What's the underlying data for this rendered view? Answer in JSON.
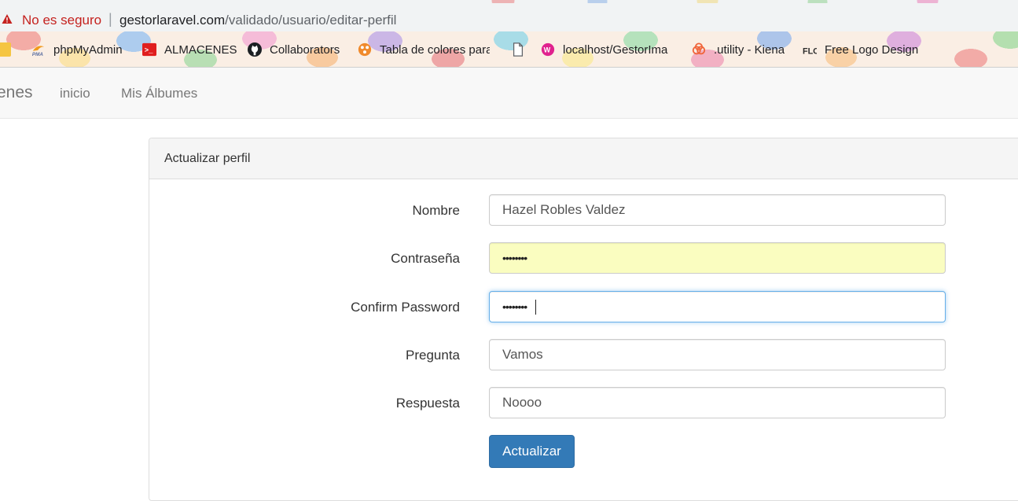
{
  "browser": {
    "security_warning": "No es seguro",
    "url_host": "gestorlaravel.com",
    "url_path": "/validado/usuario/editar-perfil"
  },
  "bookmarks": [
    {
      "label": "",
      "icon": "folder-icon"
    },
    {
      "label": "phpMyAdmin",
      "icon": "phpmyadmin-icon"
    },
    {
      "label": "ALMACENES",
      "icon": "terminal-icon"
    },
    {
      "label": "Collaborators",
      "icon": "github-icon"
    },
    {
      "label": "Tabla de colores para",
      "icon": "palette-icon"
    },
    {
      "label": "",
      "icon": "page-icon"
    },
    {
      "label": "localhost/GestorIma",
      "icon": "wamp-icon"
    },
    {
      "label": ".utility - Kiena",
      "icon": "cloud-icon"
    },
    {
      "label": "Free Logo Design",
      "icon": "flo-icon"
    }
  ],
  "navbar": {
    "brand": "enes",
    "links": [
      "inicio",
      "Mis Álbumes"
    ]
  },
  "panel": {
    "title": "Actualizar perfil"
  },
  "form": {
    "fields": [
      {
        "label": "Nombre",
        "value": "Hazel Robles Valdez",
        "type": "text"
      },
      {
        "label": "Contraseña",
        "value": "••••••••",
        "type": "password"
      },
      {
        "label": "Confirm Password",
        "value": "••••••••",
        "type": "password"
      },
      {
        "label": "Pregunta",
        "value": "Vamos",
        "type": "text"
      },
      {
        "label": "Respuesta",
        "value": "Noooo",
        "type": "text"
      }
    ],
    "submit_label": "Actualizar"
  },
  "colors": {
    "primary": "#337ab7",
    "warning": "#c5221f",
    "autofill": "#fafdc0",
    "focus": "#66afe9"
  }
}
